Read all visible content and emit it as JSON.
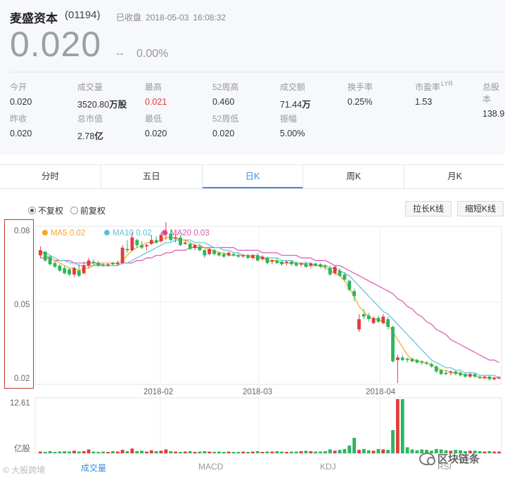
{
  "header": {
    "name": "麦盛资本",
    "code": "(01194)",
    "status": "已收盘",
    "date": "2018-05-03",
    "time": "16:08:32",
    "price": "0.020",
    "change": "--",
    "change_pct": "0.00%"
  },
  "stats": [
    {
      "label": "今开",
      "value": "0.020"
    },
    {
      "label": "成交量",
      "value": "3520.80",
      "unit": "万股"
    },
    {
      "label": "最高",
      "value": "0.021",
      "color": "#e03c3c"
    },
    {
      "label": "52周高",
      "value": "0.460"
    },
    {
      "label": "成交额",
      "value": "71.44",
      "unit": "万"
    },
    {
      "label": "换手率",
      "value": "0.25%"
    },
    {
      "label": "市盈率",
      "sup": "LYR",
      "value": "1.53"
    },
    {
      "label": "总股本",
      "value": "138.9"
    },
    {
      "label": "昨收",
      "value": "0.020"
    },
    {
      "label": "总市值",
      "value": "2.78",
      "unit": "亿"
    },
    {
      "label": "最低",
      "value": "0.020"
    },
    {
      "label": "52周低",
      "value": "0.020"
    },
    {
      "label": "振幅",
      "value": "5.00%"
    }
  ],
  "tabs": [
    "分时",
    "五日",
    "日K",
    "周K",
    "月K"
  ],
  "active_tab": "日K",
  "adjust": {
    "options": [
      "不复权",
      "前复权"
    ],
    "selected": "不复权"
  },
  "buttons": {
    "lengthen": "拉长K线",
    "shorten": "缩短K线"
  },
  "legend": [
    {
      "name": "MA5",
      "value": "0.02",
      "color": "#f5a623"
    },
    {
      "name": "MA10",
      "value": "0.02",
      "color": "#5bc0de"
    },
    {
      "name": "MA20",
      "value": "0.03",
      "color": "#e052b0"
    }
  ],
  "price_axis": {
    "ticks": [
      "0.08",
      "0.05",
      "0.02"
    ]
  },
  "date_axis": {
    "ticks": [
      "2018-02",
      "2018-03",
      "2018-04"
    ]
  },
  "volume_axis": {
    "max": "12.61",
    "unit": "亿股"
  },
  "bottom_tabs": [
    "成交量",
    "MACD",
    "KDJ",
    "RSI"
  ],
  "active_bottom_tab": "成交量",
  "watermarks": {
    "left": "大股跨境",
    "right": "区块链条"
  },
  "colors": {
    "up": "#e03c3c",
    "down": "#2eb55e",
    "accent": "#3c8ce0"
  },
  "chart_data": {
    "type": "candlestick",
    "ylim": [
      0.02,
      0.08
    ],
    "volume_max": 12.61,
    "candles": [
      [
        0.072,
        0.0735,
        0.07,
        0.069,
        "up"
      ],
      [
        0.0715,
        0.071,
        0.068,
        0.0675,
        "down"
      ],
      [
        0.0695,
        0.07,
        0.0665,
        0.066,
        "down"
      ],
      [
        0.067,
        0.068,
        0.0655,
        0.065,
        "down"
      ],
      [
        0.066,
        0.0665,
        0.064,
        0.0635,
        "down"
      ],
      [
        0.065,
        0.066,
        0.063,
        0.0625,
        "down"
      ],
      [
        0.0645,
        0.065,
        0.0625,
        0.062,
        "down"
      ],
      [
        0.0625,
        0.0655,
        0.065,
        0.0615,
        "up"
      ],
      [
        0.064,
        0.0665,
        0.062,
        0.0615,
        "down"
      ],
      [
        0.063,
        0.0675,
        0.066,
        0.0625,
        "up"
      ],
      [
        0.066,
        0.069,
        0.068,
        0.065,
        "up"
      ],
      [
        0.0675,
        0.0685,
        0.067,
        0.066,
        "down"
      ],
      [
        0.067,
        0.068,
        0.066,
        0.0655,
        "down"
      ],
      [
        0.0665,
        0.0672,
        0.066,
        0.0655,
        "down"
      ],
      [
        0.0662,
        0.067,
        0.0665,
        0.0655,
        "up"
      ],
      [
        0.067,
        0.0675,
        0.0665,
        0.066,
        "down"
      ],
      [
        0.0665,
        0.068,
        0.067,
        0.066,
        "up"
      ],
      [
        0.067,
        0.074,
        0.073,
        0.0665,
        "up"
      ],
      [
        0.0725,
        0.076,
        0.072,
        0.071,
        "down"
      ],
      [
        0.072,
        0.079,
        0.077,
        0.0715,
        "up"
      ],
      [
        0.076,
        0.0765,
        0.074,
        0.073,
        "down"
      ],
      [
        0.074,
        0.0755,
        0.073,
        0.0725,
        "down"
      ],
      [
        0.0735,
        0.0745,
        0.074,
        0.072,
        "up"
      ],
      [
        0.0745,
        0.078,
        0.076,
        0.074,
        "up"
      ],
      [
        0.076,
        0.0775,
        0.075,
        0.0745,
        "down"
      ],
      [
        0.0755,
        0.079,
        0.078,
        0.075,
        "up"
      ],
      [
        0.0785,
        0.083,
        0.079,
        0.076,
        "up"
      ],
      [
        0.0785,
        0.08,
        0.076,
        0.0755,
        "down"
      ],
      [
        0.0765,
        0.0785,
        0.077,
        0.075,
        "up"
      ],
      [
        0.077,
        0.078,
        0.074,
        0.0735,
        "down"
      ],
      [
        0.0745,
        0.076,
        0.075,
        0.074,
        "up"
      ],
      [
        0.0745,
        0.075,
        0.0725,
        0.072,
        "down"
      ],
      [
        0.073,
        0.0745,
        0.074,
        0.072,
        "up"
      ],
      [
        0.0735,
        0.0745,
        0.072,
        0.0715,
        "down"
      ],
      [
        0.072,
        0.0725,
        0.07,
        0.069,
        "down"
      ],
      [
        0.0705,
        0.073,
        0.0725,
        0.07,
        "up"
      ],
      [
        0.072,
        0.0725,
        0.0705,
        0.07,
        "down"
      ],
      [
        0.071,
        0.0715,
        0.07,
        0.0695,
        "down"
      ],
      [
        0.0705,
        0.071,
        0.0695,
        0.069,
        "down"
      ],
      [
        0.07,
        0.0715,
        0.071,
        0.0695,
        "up"
      ],
      [
        0.0705,
        0.0712,
        0.07,
        0.0695,
        "down"
      ],
      [
        0.07,
        0.0708,
        0.0695,
        0.069,
        "down"
      ],
      [
        0.0698,
        0.0705,
        0.07,
        0.069,
        "up"
      ],
      [
        0.07,
        0.0705,
        0.069,
        0.0685,
        "down"
      ],
      [
        0.069,
        0.0705,
        0.07,
        0.0685,
        "up"
      ],
      [
        0.07,
        0.071,
        0.068,
        0.0675,
        "down"
      ],
      [
        0.0685,
        0.07,
        0.0695,
        0.068,
        "up"
      ],
      [
        0.069,
        0.0695,
        0.067,
        0.0665,
        "down"
      ],
      [
        0.0675,
        0.0685,
        0.068,
        0.0665,
        "up"
      ],
      [
        0.068,
        0.069,
        0.067,
        0.0665,
        "down"
      ],
      [
        0.0675,
        0.068,
        0.0665,
        0.066,
        "down"
      ],
      [
        0.067,
        0.0678,
        0.0675,
        0.066,
        "up"
      ],
      [
        0.0675,
        0.068,
        0.0665,
        0.066,
        "down"
      ],
      [
        0.067,
        0.0675,
        0.066,
        0.0655,
        "down"
      ],
      [
        0.0665,
        0.0672,
        0.0668,
        0.0655,
        "up"
      ],
      [
        0.0668,
        0.0675,
        0.0655,
        0.065,
        "down"
      ],
      [
        0.066,
        0.0672,
        0.0668,
        0.065,
        "up"
      ],
      [
        0.0668,
        0.0672,
        0.066,
        0.0655,
        "down"
      ],
      [
        0.0665,
        0.067,
        0.0655,
        0.065,
        "down"
      ],
      [
        0.066,
        0.0665,
        0.0655,
        0.0645,
        "down"
      ],
      [
        0.065,
        0.066,
        0.0625,
        0.062,
        "down"
      ],
      [
        0.063,
        0.066,
        0.0655,
        0.0625,
        "up"
      ],
      [
        0.064,
        0.065,
        0.062,
        0.0615,
        "down"
      ],
      [
        0.0625,
        0.0635,
        0.0605,
        0.06,
        "down"
      ],
      [
        0.06,
        0.0605,
        0.0565,
        0.056,
        "down"
      ],
      [
        0.056,
        0.057,
        0.054,
        0.052,
        "down"
      ],
      [
        0.045,
        0.047,
        0.041,
        0.04,
        "up"
      ],
      [
        0.047,
        0.049,
        0.046,
        0.045,
        "down"
      ],
      [
        0.0465,
        0.0475,
        0.045,
        0.044,
        "down"
      ],
      [
        0.0435,
        0.046,
        0.0455,
        0.043,
        "up"
      ],
      [
        0.0455,
        0.0465,
        0.044,
        0.0435,
        "down"
      ],
      [
        0.0435,
        0.047,
        0.046,
        0.043,
        "up"
      ],
      [
        0.045,
        0.046,
        0.042,
        0.041,
        "down"
      ],
      [
        0.042,
        0.0425,
        0.0285,
        0.028,
        "down"
      ],
      [
        0.029,
        0.031,
        0.03,
        0.02,
        "up"
      ],
      [
        0.03,
        0.031,
        0.029,
        0.0285,
        "down"
      ],
      [
        0.0295,
        0.03,
        0.029,
        0.028,
        "down"
      ],
      [
        0.0295,
        0.03,
        0.0285,
        0.028,
        "down"
      ],
      [
        0.029,
        0.0295,
        0.028,
        0.0275,
        "down"
      ],
      [
        0.0285,
        0.029,
        0.028,
        0.027,
        "down"
      ],
      [
        0.028,
        0.0285,
        0.0275,
        0.027,
        "down"
      ],
      [
        0.0275,
        0.028,
        0.0265,
        0.026,
        "down"
      ],
      [
        0.0265,
        0.027,
        0.0245,
        0.024,
        "down"
      ],
      [
        0.025,
        0.0255,
        0.0235,
        0.023,
        "down"
      ],
      [
        0.024,
        0.025,
        0.0235,
        0.023,
        "down"
      ],
      [
        0.024,
        0.025,
        0.0245,
        0.023,
        "up"
      ],
      [
        0.0245,
        0.025,
        0.0235,
        0.023,
        "down"
      ],
      [
        0.024,
        0.0245,
        0.023,
        0.0225,
        "down"
      ],
      [
        0.0235,
        0.024,
        0.0225,
        0.022,
        "down"
      ],
      [
        0.0225,
        0.024,
        0.0235,
        0.022,
        "up"
      ],
      [
        0.0235,
        0.024,
        0.0225,
        0.022,
        "down"
      ],
      [
        0.0225,
        0.023,
        0.022,
        0.0215,
        "down"
      ],
      [
        0.022,
        0.023,
        0.0225,
        0.0215,
        "up"
      ],
      [
        0.0225,
        0.023,
        0.0215,
        0.021,
        "down"
      ],
      [
        0.0215,
        0.0225,
        0.022,
        0.021,
        "up"
      ],
      [
        0.022,
        0.0228,
        0.0222,
        0.0215,
        "up"
      ]
    ],
    "ma5": [
      0.072,
      0.07,
      0.069,
      0.068,
      0.067,
      0.066,
      0.065,
      0.065,
      0.064,
      0.065,
      0.065,
      0.066,
      0.067,
      0.067,
      0.067,
      0.067,
      0.067,
      0.068,
      0.07,
      0.072,
      0.073,
      0.074,
      0.075,
      0.075,
      0.075,
      0.076,
      0.077,
      0.077,
      0.077,
      0.076,
      0.076,
      0.075,
      0.074,
      0.074,
      0.073,
      0.072,
      0.072,
      0.071,
      0.071,
      0.07,
      0.07,
      0.07,
      0.07,
      0.07,
      0.069,
      0.069,
      0.069,
      0.068,
      0.068,
      0.068,
      0.067,
      0.067,
      0.067,
      0.067,
      0.067,
      0.066,
      0.066,
      0.066,
      0.066,
      0.065,
      0.064,
      0.063,
      0.062,
      0.06,
      0.057,
      0.054,
      0.05,
      0.048,
      0.046,
      0.045,
      0.045,
      0.044,
      0.043,
      0.04,
      0.037,
      0.034,
      0.031,
      0.029,
      0.029,
      0.028,
      0.028,
      0.027,
      0.026,
      0.025,
      0.025,
      0.024,
      0.024,
      0.024,
      0.023,
      0.023,
      0.023,
      0.022,
      0.022,
      0.022,
      0.022,
      0.022
    ],
    "ma10": [
      0.071,
      0.071,
      0.07,
      0.069,
      0.068,
      0.068,
      0.067,
      0.067,
      0.066,
      0.066,
      0.066,
      0.066,
      0.066,
      0.066,
      0.066,
      0.066,
      0.066,
      0.067,
      0.067,
      0.068,
      0.069,
      0.07,
      0.071,
      0.072,
      0.073,
      0.074,
      0.075,
      0.075,
      0.076,
      0.076,
      0.076,
      0.076,
      0.075,
      0.075,
      0.075,
      0.074,
      0.073,
      0.073,
      0.072,
      0.072,
      0.071,
      0.071,
      0.07,
      0.07,
      0.07,
      0.07,
      0.069,
      0.069,
      0.069,
      0.069,
      0.068,
      0.068,
      0.068,
      0.067,
      0.067,
      0.067,
      0.067,
      0.066,
      0.066,
      0.066,
      0.065,
      0.065,
      0.064,
      0.063,
      0.062,
      0.06,
      0.058,
      0.056,
      0.054,
      0.052,
      0.05,
      0.048,
      0.047,
      0.045,
      0.043,
      0.041,
      0.039,
      0.037,
      0.035,
      0.033,
      0.031,
      0.029,
      0.028,
      0.027,
      0.026,
      0.026,
      0.025,
      0.025,
      0.024,
      0.024,
      0.024,
      0.023,
      0.023,
      0.023,
      0.023,
      0.022
    ],
    "ma20": [
      0.069,
      0.069,
      0.069,
      0.068,
      0.068,
      0.068,
      0.068,
      0.067,
      0.067,
      0.067,
      0.067,
      0.067,
      0.067,
      0.066,
      0.066,
      0.066,
      0.066,
      0.067,
      0.067,
      0.067,
      0.068,
      0.068,
      0.069,
      0.069,
      0.07,
      0.07,
      0.071,
      0.071,
      0.072,
      0.072,
      0.072,
      0.073,
      0.073,
      0.073,
      0.073,
      0.073,
      0.073,
      0.073,
      0.073,
      0.073,
      0.073,
      0.072,
      0.072,
      0.072,
      0.072,
      0.072,
      0.071,
      0.071,
      0.071,
      0.071,
      0.07,
      0.07,
      0.07,
      0.07,
      0.069,
      0.069,
      0.069,
      0.068,
      0.068,
      0.068,
      0.067,
      0.066,
      0.066,
      0.065,
      0.064,
      0.063,
      0.062,
      0.061,
      0.06,
      0.059,
      0.058,
      0.057,
      0.056,
      0.055,
      0.053,
      0.052,
      0.05,
      0.049,
      0.047,
      0.046,
      0.044,
      0.043,
      0.041,
      0.04,
      0.039,
      0.037,
      0.036,
      0.035,
      0.034,
      0.033,
      0.032,
      0.031,
      0.03,
      0.029,
      0.029,
      0.028
    ],
    "volumes": [
      0.4,
      0.3,
      0.5,
      0.3,
      0.4,
      0.5,
      0.4,
      0.6,
      0.4,
      0.5,
      0.9,
      0.4,
      0.3,
      0.4,
      0.3,
      0.5,
      0.4,
      0.8,
      0.5,
      1.1,
      0.5,
      0.6,
      0.4,
      0.7,
      0.5,
      0.6,
      0.9,
      0.5,
      0.4,
      0.3,
      0.4,
      0.5,
      0.3,
      0.4,
      0.5,
      0.4,
      0.3,
      0.4,
      0.3,
      0.4,
      0.3,
      0.3,
      0.4,
      0.3,
      0.4,
      0.5,
      0.3,
      0.4,
      0.4,
      0.5,
      0.4,
      0.3,
      0.4,
      0.4,
      0.5,
      0.6,
      0.5,
      0.4,
      0.4,
      0.5,
      0.9,
      0.6,
      0.8,
      1.0,
      1.8,
      3.6,
      0.8,
      1.0,
      0.7,
      0.6,
      1.0,
      0.9,
      0.8,
      5.4,
      12.61,
      12.61,
      1.4,
      0.9,
      0.7,
      0.9,
      0.8,
      0.6,
      1.0,
      0.9,
      0.7,
      0.6,
      0.8,
      0.7,
      0.5,
      0.6,
      0.6,
      0.5,
      0.4,
      0.5,
      0.4,
      0.4
    ]
  }
}
